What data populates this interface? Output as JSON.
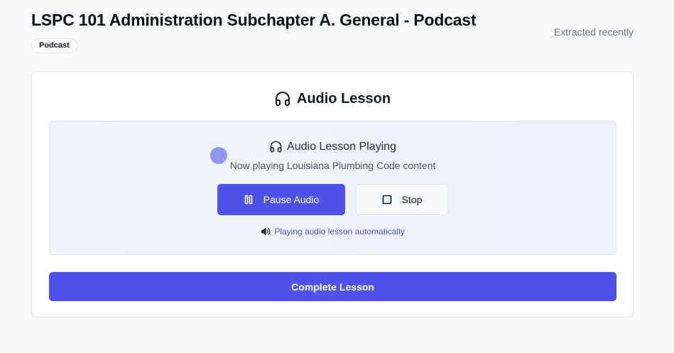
{
  "header": {
    "title": "LSPC 101 Administration Subchapter A. General - Podcast",
    "badge": "Podcast",
    "meta": "Extracted recently"
  },
  "lesson": {
    "title": "Audio Lesson",
    "title_icon": "headphones-icon",
    "player": {
      "status_title": "Audio Lesson Playing",
      "status_icon": "headphones-icon",
      "status_subtitle": "Now playing Louisiana Plumbing Code content",
      "pause_label": "Pause Audio",
      "pause_icon": "pause-icon",
      "stop_label": "Stop",
      "stop_icon": "stop-icon",
      "auto_note": "Playing audio lesson automatically",
      "auto_note_icon": "speaker-icon",
      "indicator_color": "#9097ee"
    },
    "complete_label": "Complete Lesson"
  },
  "colors": {
    "accent": "#4f52e8",
    "background": "#f8f9fb",
    "player_bg": "#eef0fd"
  }
}
